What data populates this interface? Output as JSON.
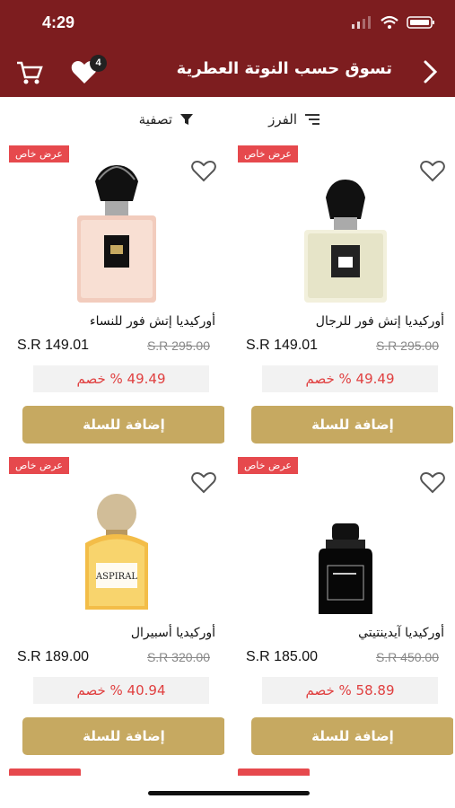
{
  "status": {
    "time": "4:29"
  },
  "header": {
    "title": "تسوق حسب النوتة العطرية",
    "wishlist_count": "4"
  },
  "toolbar": {
    "sort": "الفرز",
    "filter": "تصفية"
  },
  "colors": {
    "header": "#7d1d1f",
    "button": "#c6a961",
    "promo": "#e6494d",
    "discount_text": "#e04040"
  },
  "products": [
    {
      "name": "أوركيديا إتش فور للنساء",
      "old_price": "S.R 295.00",
      "new_price": "S.R 149.01",
      "discount": "49.49 % خصم",
      "promo": "عرض خاص",
      "button": "إضافة للسلة",
      "bottle": "rose"
    },
    {
      "name": "أوركيديا إتش فور للرجال",
      "old_price": "S.R 295.00",
      "new_price": "S.R 149.01",
      "discount": "49.49 % خصم",
      "promo": "عرض خاص",
      "button": "إضافة للسلة",
      "bottle": "pale"
    },
    {
      "name": "أوركيديا أسبيرال",
      "old_price": "S.R 320.00",
      "new_price": "S.R 189.00",
      "discount": "40.94 % خصم",
      "promo": "عرض خاص",
      "button": "إضافة للسلة",
      "bottle": "amber",
      "label": "ASPIRAL"
    },
    {
      "name": "أوركيديا آيدينتيتي",
      "old_price": "S.R 450.00",
      "new_price": "S.R 185.00",
      "discount": "58.89 % خصم",
      "promo": "عرض خاص",
      "button": "إضافة للسلة",
      "bottle": "black"
    }
  ]
}
